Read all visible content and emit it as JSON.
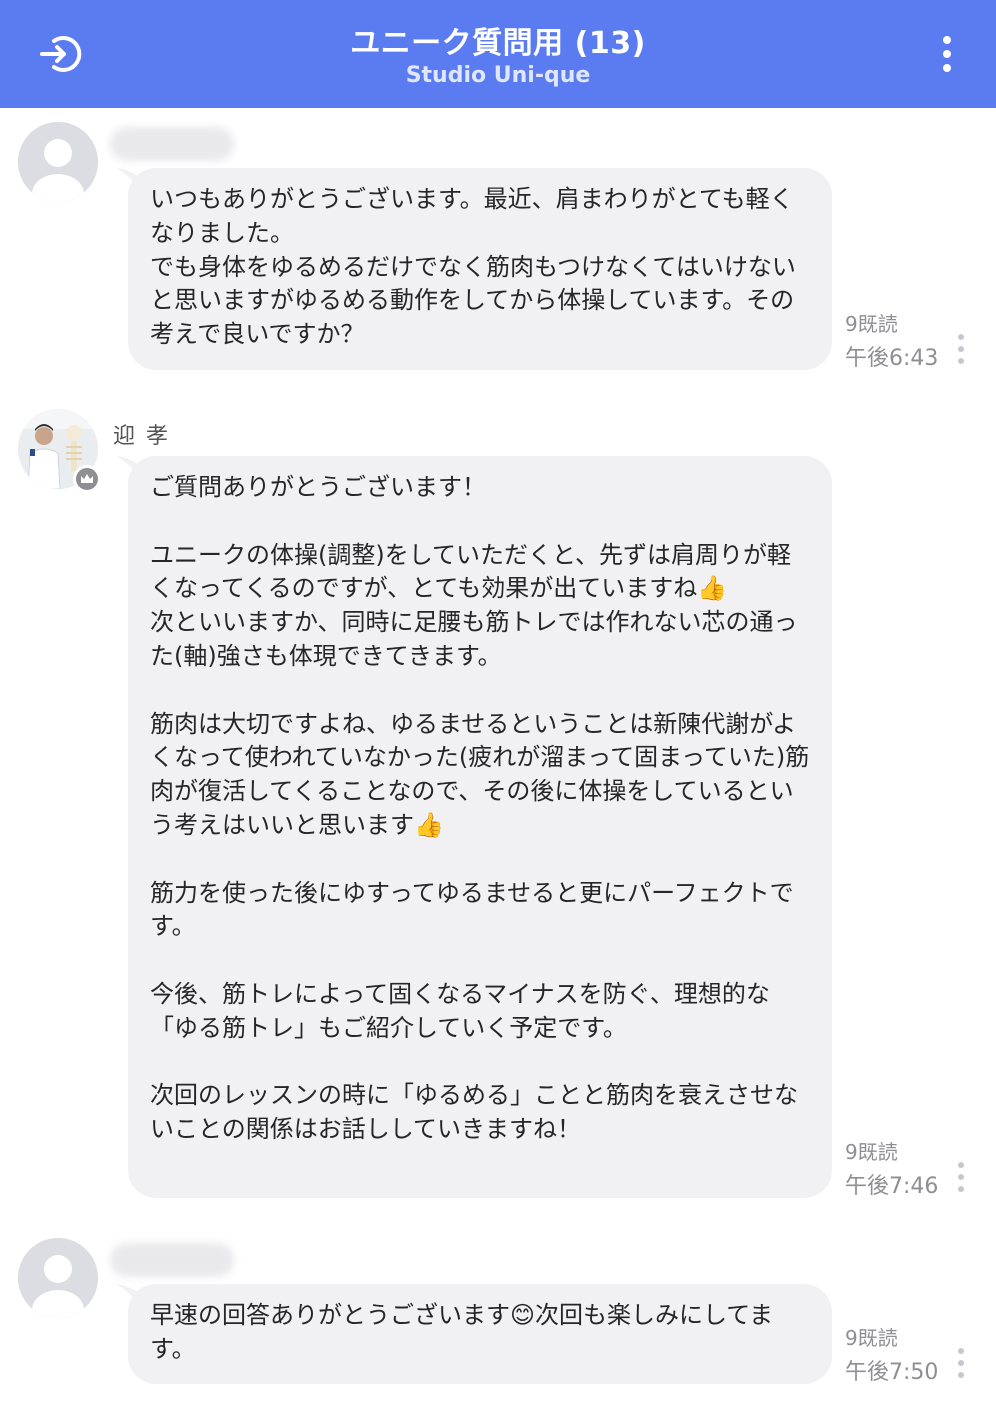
{
  "header": {
    "title": "ユニーク質問用 (13)",
    "subtitle": "Studio Uni-que",
    "exit_icon": "exit-icon",
    "menu_icon": "more-vertical-icon",
    "background": "#5b7cf0"
  },
  "messages": [
    {
      "sender": "",
      "text": "いつもありがとうございます。最近、肩まわりがとても軽くなりました。\nでも身体をゆるめるだけでなく筋肉もつけなくてはいけないと思いますがゆるめる動作をしてから体操しています。その考えで良いですか？",
      "read": "9既読",
      "time": "午後6:43"
    },
    {
      "sender": "迎 孝",
      "text": "ご質問ありがとうございます！\n\nユニークの体操(調整)をしていただくと、先ずは肩周りが軽くなってくるのですが、とても効果が出ていますね👍\n次といいますか、同時に足腰も筋トレでは作れない芯の通った(軸)強さも体現できてきます。\n\n筋肉は大切ですよね、ゆるませるということは新陳代謝がよくなって使われていなかった(疲れが溜まって固まっていた)筋肉が復活してくることなので、その後に体操をしているという考えはいいと思います👍\n\n筋力を使った後にゆすってゆるませると更にパーフェクトです。\n\n今後、筋トレによって固くなるマイナスを防ぐ、理想的な「ゆる筋トレ」もご紹介していく予定です。\n\n次回のレッスンの時に「ゆるめる」ことと筋肉を衰えさせないことの関係はお話ししていきますね！",
      "read": "9既読",
      "time": "午後7:46"
    },
    {
      "sender": "",
      "text": "早速の回答ありがとうございます😊次回も楽しみにしてます。",
      "read": "9既読",
      "time": "午後7:50"
    }
  ]
}
